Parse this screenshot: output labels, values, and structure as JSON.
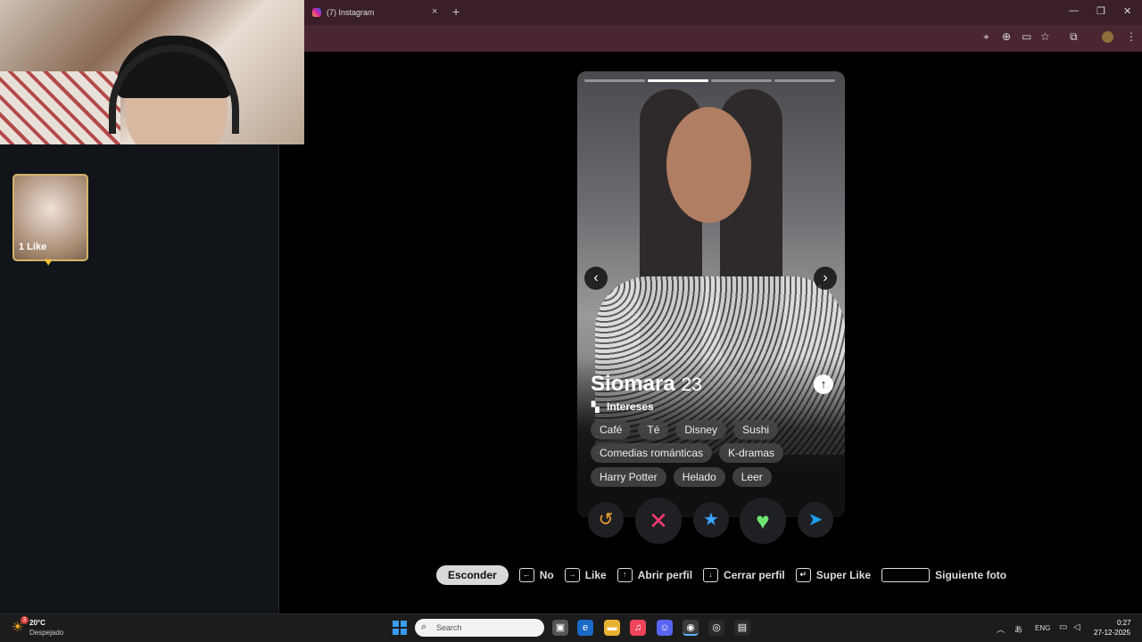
{
  "browser": {
    "tab_title": "(7) Instagram",
    "tab_close": "×",
    "new_tab": "+",
    "win_minimize": "—",
    "win_restore": "❐",
    "win_close": "✕"
  },
  "left_panel": {
    "like_label": "1 Like"
  },
  "profile": {
    "name": "Siomara",
    "age": "23",
    "interests_heading": "Intereses",
    "interests_rows": [
      [
        "Café",
        "Té",
        "Disney",
        "Sushi"
      ],
      [
        "Comedias románticas",
        "K-dramas"
      ],
      [
        "Harry Potter",
        "Helado",
        "Leer"
      ]
    ],
    "photo_count": 4,
    "active_photo": 2
  },
  "hints": {
    "hide": "Esconder",
    "no": "No",
    "like": "Like",
    "open_profile": "Abrir perfil",
    "close_profile": "Cerrar perfil",
    "super_like": "Super Like",
    "next_photo": "Siguiente foto"
  },
  "taskbar": {
    "weather_badge": "3",
    "weather_temp": "20°C",
    "weather_desc": "Despejado",
    "search_placeholder": "Search",
    "lang": "ENG",
    "time": "0:27",
    "date": "27-12-2025"
  },
  "colors": {
    "rewind": "#f0a030",
    "nope": "#fe3c72",
    "superlike": "#3ca4ff",
    "like": "#6ee36e",
    "boost": "#1ca0f2"
  }
}
